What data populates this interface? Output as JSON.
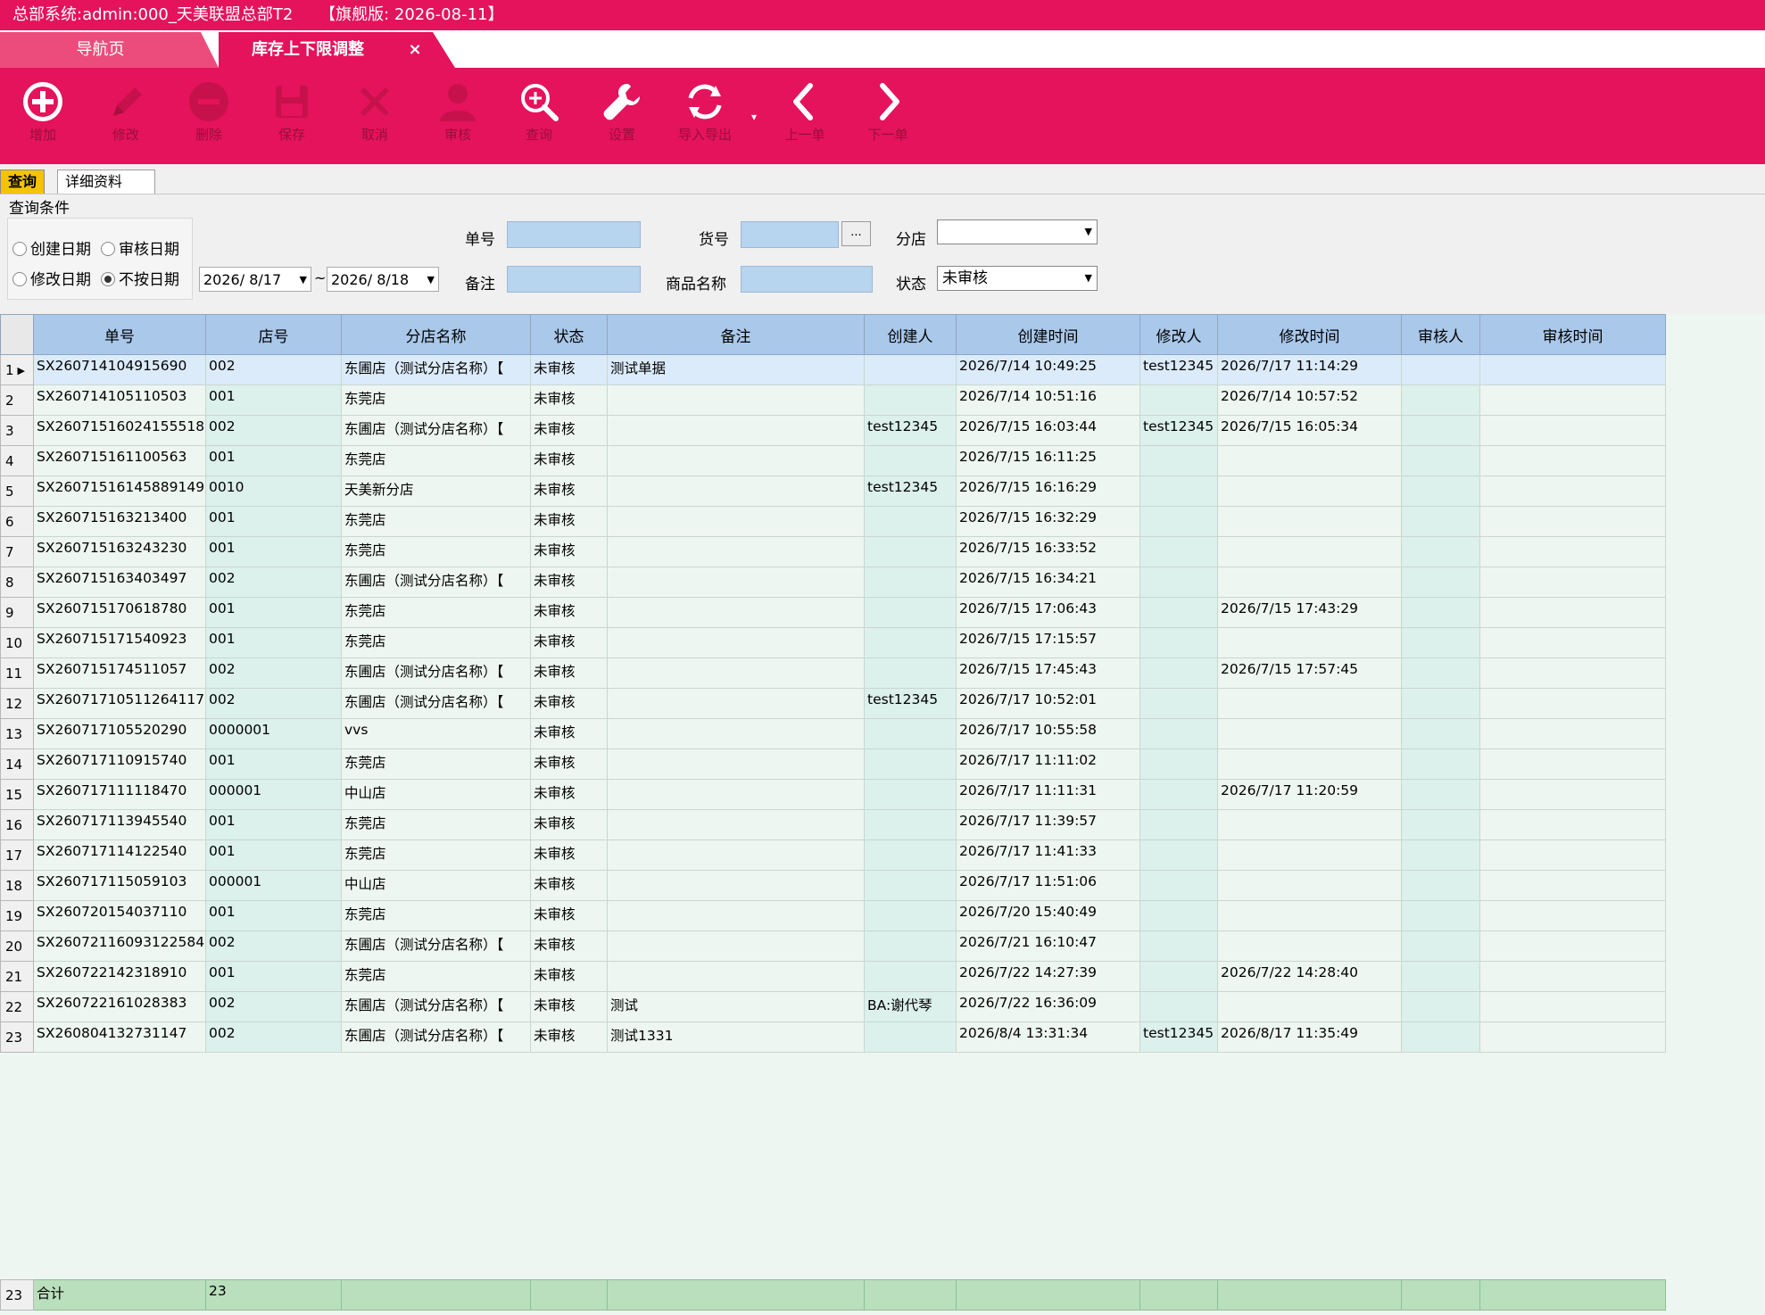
{
  "window": {
    "title": "总部系统:admin:000_天美联盟总部T2",
    "edition": "【旗舰版: 2026-08-11】"
  },
  "tabs": {
    "nav_label": "导航页",
    "active_label": "库存上下限调整",
    "close_glyph": "×"
  },
  "toolbar": {
    "add": "增加",
    "edit": "修改",
    "delete": "删除",
    "save": "保存",
    "cancel": "取消",
    "audit": "审核",
    "query": "查询",
    "settings": "设置",
    "import_export": "导入导出",
    "prev": "上一单",
    "next": "下一单"
  },
  "subtabs": {
    "query": "查询",
    "detail": "详细资料"
  },
  "query": {
    "title": "查询条件",
    "radios": {
      "created": "创建日期",
      "audited": "审核日期",
      "modified": "修改日期",
      "none": "不按日期"
    },
    "selected_radio": "none",
    "date_from": "2026/ 8/17",
    "date_tilde": "~",
    "date_to": "2026/ 8/18",
    "order_no_label": "单号",
    "remark_label": "备注",
    "item_no_label": "货号",
    "ellipsis": "...",
    "product_name_label": "商品名称",
    "branch_label": "分店",
    "branch_value": "",
    "status_label": "状态",
    "status_value": "未审核"
  },
  "grid": {
    "headers": [
      "单号",
      "店号",
      "分店名称",
      "状态",
      "备注",
      "创建人",
      "创建时间",
      "修改人",
      "修改时间",
      "审核人",
      "审核时间"
    ],
    "rows": [
      [
        "1",
        "SX260714104915690",
        "002",
        "东圃店（测试分店名称）【",
        "未审核",
        "测试单据",
        "",
        "2026/7/14 10:49:25",
        "test12345",
        "2026/7/17 11:14:29",
        "",
        ""
      ],
      [
        "2",
        "SX260714105110503",
        "001",
        "东莞店",
        "未审核",
        "",
        "",
        "2026/7/14 10:51:16",
        "",
        "2026/7/14 10:57:52",
        "",
        ""
      ],
      [
        "3",
        "SX26071516024155518",
        "002",
        "东圃店（测试分店名称）【",
        "未审核",
        "",
        "test12345",
        "2026/7/15 16:03:44",
        "test12345",
        "2026/7/15 16:05:34",
        "",
        ""
      ],
      [
        "4",
        "SX260715161100563",
        "001",
        "东莞店",
        "未审核",
        "",
        "",
        "2026/7/15 16:11:25",
        "",
        "",
        "",
        ""
      ],
      [
        "5",
        "SX26071516145889149",
        "0010",
        "天美新分店",
        "未审核",
        "",
        "test12345",
        "2026/7/15 16:16:29",
        "",
        "",
        "",
        ""
      ],
      [
        "6",
        "SX260715163213400",
        "001",
        "东莞店",
        "未审核",
        "",
        "",
        "2026/7/15 16:32:29",
        "",
        "",
        "",
        ""
      ],
      [
        "7",
        "SX260715163243230",
        "001",
        "东莞店",
        "未审核",
        "",
        "",
        "2026/7/15 16:33:52",
        "",
        "",
        "",
        ""
      ],
      [
        "8",
        "SX260715163403497",
        "002",
        "东圃店（测试分店名称）【",
        "未审核",
        "",
        "",
        "2026/7/15 16:34:21",
        "",
        "",
        "",
        ""
      ],
      [
        "9",
        "SX260715170618780",
        "001",
        "东莞店",
        "未审核",
        "",
        "",
        "2026/7/15 17:06:43",
        "",
        "2026/7/15 17:43:29",
        "",
        ""
      ],
      [
        "10",
        "SX260715171540923",
        "001",
        "东莞店",
        "未审核",
        "",
        "",
        "2026/7/15 17:15:57",
        "",
        "",
        "",
        ""
      ],
      [
        "11",
        "SX260715174511057",
        "002",
        "东圃店（测试分店名称）【",
        "未审核",
        "",
        "",
        "2026/7/15 17:45:43",
        "",
        "2026/7/15 17:57:45",
        "",
        ""
      ],
      [
        "12",
        "SX26071710511264117",
        "002",
        "东圃店（测试分店名称）【",
        "未审核",
        "",
        "test12345",
        "2026/7/17 10:52:01",
        "",
        "",
        "",
        ""
      ],
      [
        "13",
        "SX260717105520290",
        "0000001",
        "vvs",
        "未审核",
        "",
        "",
        "2026/7/17 10:55:58",
        "",
        "",
        "",
        ""
      ],
      [
        "14",
        "SX260717110915740",
        "001",
        "东莞店",
        "未审核",
        "",
        "",
        "2026/7/17 11:11:02",
        "",
        "",
        "",
        ""
      ],
      [
        "15",
        "SX260717111118470",
        "000001",
        "中山店",
        "未审核",
        "",
        "",
        "2026/7/17 11:11:31",
        "",
        "2026/7/17 11:20:59",
        "",
        ""
      ],
      [
        "16",
        "SX260717113945540",
        "001",
        "东莞店",
        "未审核",
        "",
        "",
        "2026/7/17 11:39:57",
        "",
        "",
        "",
        ""
      ],
      [
        "17",
        "SX260717114122540",
        "001",
        "东莞店",
        "未审核",
        "",
        "",
        "2026/7/17 11:41:33",
        "",
        "",
        "",
        ""
      ],
      [
        "18",
        "SX260717115059103",
        "000001",
        "中山店",
        "未审核",
        "",
        "",
        "2026/7/17 11:51:06",
        "",
        "",
        "",
        ""
      ],
      [
        "19",
        "SX260720154037110",
        "001",
        "东莞店",
        "未审核",
        "",
        "",
        "2026/7/20 15:40:49",
        "",
        "",
        "",
        ""
      ],
      [
        "20",
        "SX26072116093122584",
        "002",
        "东圃店（测试分店名称）【",
        "未审核",
        "",
        "",
        "2026/7/21 16:10:47",
        "",
        "",
        "",
        ""
      ],
      [
        "21",
        "SX260722142318910",
        "001",
        "东莞店",
        "未审核",
        "",
        "",
        "2026/7/22 14:27:39",
        "",
        "2026/7/22 14:28:40",
        "",
        ""
      ],
      [
        "22",
        "SX260722161028383",
        "002",
        "东圃店（测试分店名称）【",
        "未审核",
        "测试",
        "BA:谢代琴",
        "2026/7/22 16:36:09",
        "",
        "",
        "",
        ""
      ],
      [
        "23",
        "SX260804132731147",
        "002",
        "东圃店（测试分店名称）【",
        "未审核",
        "测试1331",
        "",
        "2026/8/4 13:31:34",
        "test12345",
        "2026/8/17 11:35:49",
        "",
        ""
      ]
    ],
    "footer": {
      "row_count": "23",
      "total_label": "合计",
      "total_value": "23"
    }
  },
  "colors": {
    "brand": "#e4135b",
    "header": "#a9c8ea",
    "footer": "#b9dfbc",
    "selected_tab": "#f5c400"
  }
}
